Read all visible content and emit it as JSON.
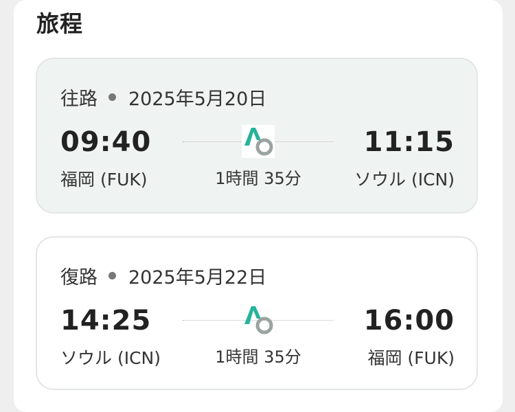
{
  "itinerary": {
    "title": "旅程",
    "outbound": {
      "label": "往路",
      "date": "2025年5月20日",
      "departure_time": "09:40",
      "departure_place": "福岡 (FUK)",
      "arrival_time": "11:15",
      "arrival_place": "ソウル (ICN)",
      "duration": "1時間 35分"
    },
    "inbound": {
      "label": "復路",
      "date": "2025年5月22日",
      "departure_time": "14:25",
      "departure_place": "ソウル (ICN)",
      "arrival_time": "16:00",
      "arrival_place": "福岡 (FUK)",
      "duration": "1時間 35分"
    }
  },
  "colors": {
    "accent": "#27b39a",
    "logo_ring": "#9aa39f",
    "outbound_bg": "#eff3f2"
  },
  "icons": {
    "airline_logo": "airline-logo-icon"
  }
}
